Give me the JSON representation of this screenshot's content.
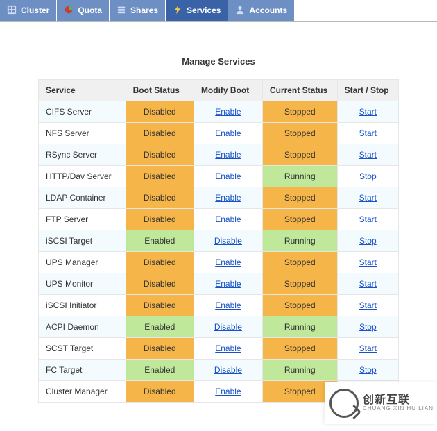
{
  "nav": {
    "items": [
      {
        "label": "Cluster",
        "icon": "cluster-icon",
        "active": false
      },
      {
        "label": "Quota",
        "icon": "quota-icon",
        "active": false
      },
      {
        "label": "Shares",
        "icon": "shares-icon",
        "active": false
      },
      {
        "label": "Services",
        "icon": "services-icon",
        "active": true
      },
      {
        "label": "Accounts",
        "icon": "accounts-icon",
        "active": false
      }
    ]
  },
  "page": {
    "title": "Manage Services"
  },
  "table": {
    "columns": {
      "service": "Service",
      "boot_status": "Boot Status",
      "modify_boot": "Modify Boot",
      "current_status": "Current Status",
      "start_stop": "Start / Stop"
    },
    "labels": {
      "enabled": "Enabled",
      "disabled": "Disabled",
      "running": "Running",
      "stopped": "Stopped",
      "enable": "Enable",
      "disable": "Disable",
      "start": "Start",
      "stop": "Stop"
    },
    "rows": [
      {
        "service": "CIFS Server",
        "boot": "disabled",
        "current": "stopped"
      },
      {
        "service": "NFS Server",
        "boot": "disabled",
        "current": "stopped"
      },
      {
        "service": "RSync Server",
        "boot": "disabled",
        "current": "stopped"
      },
      {
        "service": "HTTP/Dav Server",
        "boot": "disabled",
        "current": "running"
      },
      {
        "service": "LDAP Container",
        "boot": "disabled",
        "current": "stopped"
      },
      {
        "service": "FTP Server",
        "boot": "disabled",
        "current": "stopped"
      },
      {
        "service": "iSCSI Target",
        "boot": "enabled",
        "current": "running"
      },
      {
        "service": "UPS Manager",
        "boot": "disabled",
        "current": "stopped"
      },
      {
        "service": "UPS Monitor",
        "boot": "disabled",
        "current": "stopped"
      },
      {
        "service": "iSCSI Initiator",
        "boot": "disabled",
        "current": "stopped"
      },
      {
        "service": "ACPI Daemon",
        "boot": "enabled",
        "current": "running"
      },
      {
        "service": "SCST Target",
        "boot": "disabled",
        "current": "stopped"
      },
      {
        "service": "FC Target",
        "boot": "enabled",
        "current": "running"
      },
      {
        "service": "Cluster Manager",
        "boot": "disabled",
        "current": "stopped"
      }
    ]
  },
  "watermark": {
    "big": "创新互联",
    "small": "CHUANG XIN HU LIAN"
  },
  "colors": {
    "nav_bg": "#6d8fc4",
    "nav_active_bg": "#3963a6",
    "status_orange": "#f5b548",
    "status_green": "#bfe89a",
    "link": "#1852c7"
  }
}
